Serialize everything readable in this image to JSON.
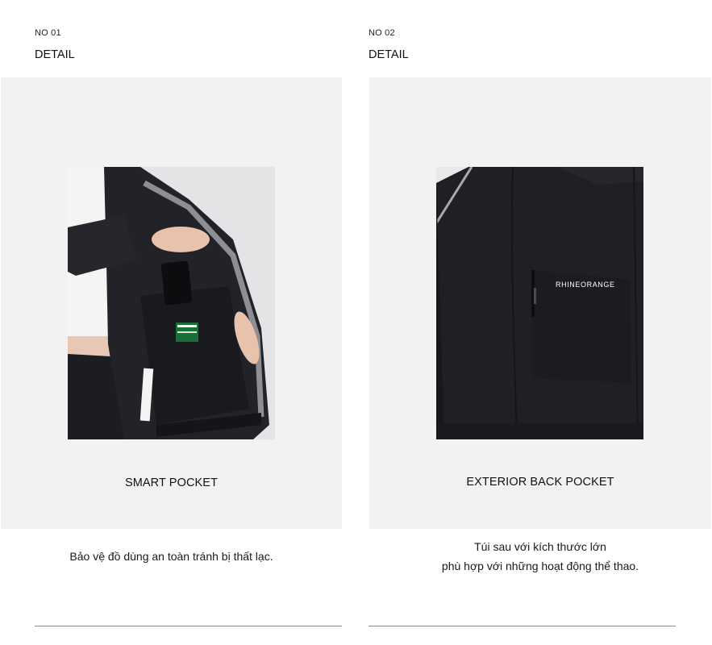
{
  "items": [
    {
      "number": "NO 01",
      "section": "DETAIL",
      "title": "SMART POCKET",
      "description_lines": [
        "Bảo vệ đồ dùng an toàn tránh bị thất lạc."
      ],
      "image": "jacket-inner-pocket-photo"
    },
    {
      "number": "NO 02",
      "section": "DETAIL",
      "title": "EXTERIOR BACK POCKET",
      "description_lines": [
        "Túi sau với kích thước lớn",
        "phù hợp với những hoạt động thể thao."
      ],
      "image": "jacket-back-pocket-photo",
      "brand_text": "RHINEORANGE"
    }
  ],
  "colors": {
    "page_bg": "#ffffff",
    "panel_bg": "#f2f2f2",
    "jacket": "#1f2024",
    "divider": "#8a8a8a"
  }
}
